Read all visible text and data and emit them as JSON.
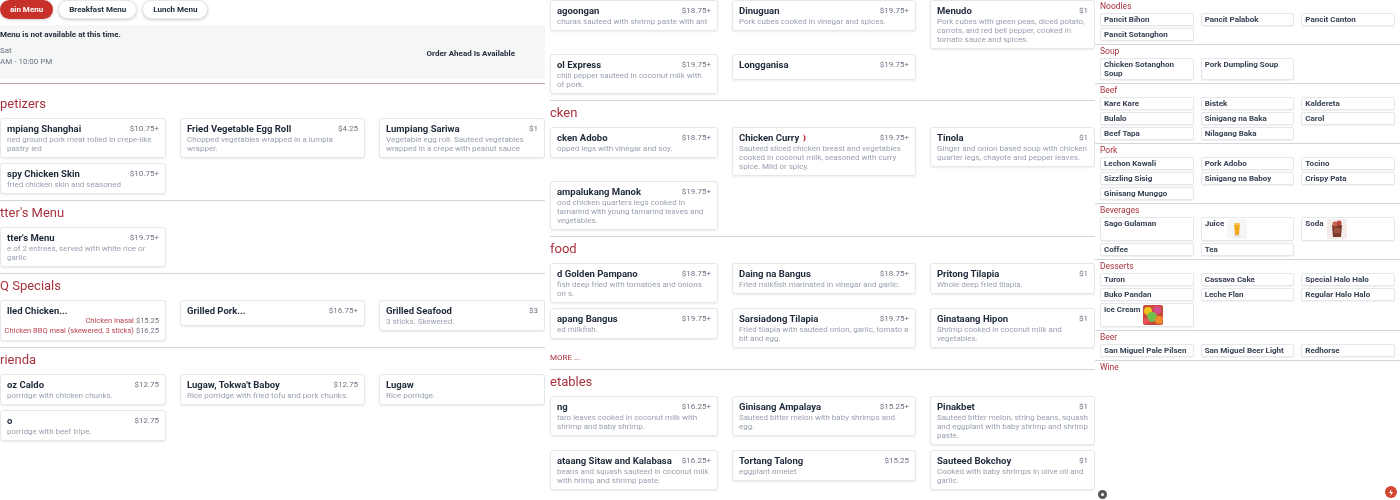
{
  "tabs": [
    {
      "label": "ain Menu",
      "selected": true
    },
    {
      "label": "Breakfast Menu",
      "selected": false
    },
    {
      "label": "Lunch Menu",
      "selected": false
    }
  ],
  "notice": {
    "message": "Menu is not available at this time.",
    "day": "Sat",
    "hours": "AM - 10:00 PM",
    "order_ahead": "Order Ahead Is Available"
  },
  "left_sections": [
    {
      "title": "petizers",
      "rows": [
        [
          {
            "name": "mpiang Shanghai",
            "price": "$10.75+",
            "description": "ned ground pork meat rolled in crepe-like pastry ied"
          },
          {
            "name": "Fried Vegetable Egg Roll",
            "price": "$4.25",
            "description": "Chopped vegetables wrapped in a lumpia wrapper."
          },
          {
            "name": "Lumpiang Sariwa",
            "price": "$1",
            "description": "Vegetable egg roll. Sauteed vegetables wrapped in a crepe with peanut sauce"
          }
        ],
        [
          {
            "name": "spy Chicken Skin",
            "price": "$10.75+",
            "description": "fried chicken skin and seasoned"
          }
        ]
      ]
    },
    {
      "title": "tter's Menu",
      "rows": [
        [
          {
            "name": "tter's Menu",
            "price": "$19.75+",
            "description": "e of 2 entrees, served with white rice or garlic"
          }
        ]
      ]
    },
    {
      "title": "Q Specials",
      "rows": [
        [
          {
            "name": "lled Chicken...",
            "options": [
              {
                "name": "Chicken Inasal",
                "price": "$15.25"
              },
              {
                "name": "Chicken BBQ meal (skewered, 3 sticks)",
                "price": "$16.25"
              }
            ]
          },
          {
            "name": "Grilled Pork...",
            "price": "$16.75+"
          },
          {
            "name": "Grilled Seafood",
            "price": "$3",
            "description": "3 sticks. Skewered."
          }
        ]
      ]
    },
    {
      "title": "rienda",
      "rows": [
        [
          {
            "name": "oz Caldo",
            "price": "$12.75",
            "description": "porridge with chicken chunks."
          },
          {
            "name": "Lugaw, Tokwa't Baboy",
            "price": "$12.75",
            "description": "Rice porridge with fried tofu and pork chunks."
          },
          {
            "name": "Lugaw",
            "description": "Rice porridge."
          }
        ],
        [
          {
            "name": "o",
            "price": "$12.75",
            "description": "porridge with beef tripe."
          }
        ]
      ]
    }
  ],
  "middle_sections": [
    {
      "rows": [
        [
          {
            "name": "agoongan",
            "price": "$18.75+",
            "description": "churas sauteed with shrimp paste with ant"
          },
          {
            "name": "Dinuguan",
            "price": "$19.75+",
            "description": "Pork cubes cooked in vinegar and spices."
          },
          {
            "name": "Menudo",
            "price": "$1",
            "description": "Pork cubes with green peas, diced potato, carrots, and red bell pepper, cooked in tomato sauce and spices."
          }
        ],
        [
          {
            "name": "ol Express",
            "price": "$19.75+",
            "description": "chili pepper sauteed in coconut milk with of pork."
          },
          {
            "name": "Longganisa",
            "price": "$19.75+"
          }
        ]
      ]
    },
    {
      "title": "cken",
      "rows": [
        [
          {
            "name": "cken Adobo",
            "price": "$18.75+",
            "description": "opped legs with vinegar and soy."
          },
          {
            "name": "Chicken Curry",
            "spicy": true,
            "price": "$19.75+",
            "description": "Sauteed sliced chicken breast and vegetables cooked in coconut milk, seasoned with curry spice. Mild or spicy."
          },
          {
            "name": "Tinola",
            "price": "$1",
            "description": "Ginger and onion based soup with chicken quarter legs, chayote and pepper leaves."
          }
        ],
        [
          {
            "name": "ampalukang Manok",
            "price": "$19.75+",
            "description": "ood chicken quarters legs cooked in tamarind with young tamarind leaves and vegetables."
          }
        ]
      ]
    },
    {
      "title": "food",
      "more": "MORE ...",
      "rows": [
        [
          {
            "name": "d Golden Pampano",
            "price": "$18.75+",
            "description": "fish deep fried with tomatoes and onions on s."
          },
          {
            "name": "Daing na Bangus",
            "price": "$18.75+",
            "description": "Fried milkfish marinated in vinegar and garlic."
          },
          {
            "name": "Pritong Tilapia",
            "price": "$1",
            "description": "Whole deep fried tilapia."
          }
        ],
        [
          {
            "name": "apang Bangus",
            "price": "$19.75+",
            "description": "ed milkfish."
          },
          {
            "name": "Sarsiadong Tilapia",
            "price": "$19.75+",
            "description": "Fried tilapia with sauteed onion, garlic, tomato a bit and egg."
          },
          {
            "name": "Ginataang Hipon",
            "price": "$1",
            "description": "Shrimp cooked in coconut milk and vegetables."
          }
        ]
      ]
    },
    {
      "title": "etables",
      "rows": [
        [
          {
            "name": "ng",
            "price": "$16.25+",
            "description": "taro leaves cooked in coconut milk with shrimp and baby shrimp."
          },
          {
            "name": "Ginisang Ampalaya",
            "price": "$15.25+",
            "description": "Sauteed bitter melon with baby shrimps and egg."
          },
          {
            "name": "Pinakbet",
            "price": "$1",
            "description": "Sauteed bitter melon, string beans, squash and eggplant with baby shrimp and shrimp paste."
          }
        ],
        [
          {
            "name": "ataang Sitaw and Kalabasa",
            "price": "$16.25+",
            "description": "beans and squash sauteed in coconut milk with hrimp and shrimp paste."
          },
          {
            "name": "Tortang Talong",
            "price": "$15.25",
            "description": "eggplant omelet"
          },
          {
            "name": "Sauteed Bokchoy",
            "price": "$1",
            "description": "Cooked with baby shrimps in olive oil and garlic."
          }
        ]
      ]
    }
  ],
  "right_sections": [
    {
      "title": "Noodles",
      "rows": [
        [
          {
            "name": "Pancit Bihon"
          },
          {
            "name": "Pancit Palabok"
          },
          {
            "name": "Pancit Canton"
          }
        ],
        [
          {
            "name": "Pancit Sotanghon"
          }
        ]
      ]
    },
    {
      "title": "Soup",
      "rows": [
        [
          {
            "name": "Chicken Sotanghon Soup"
          },
          {
            "name": "Pork Dumpling Soup"
          }
        ]
      ]
    },
    {
      "title": "Beef",
      "rows": [
        [
          {
            "name": "Kare Kare"
          },
          {
            "name": "Bistek"
          },
          {
            "name": "Kaldereta"
          }
        ],
        [
          {
            "name": "Bulalo"
          },
          {
            "name": "Sinigang na Baka"
          },
          {
            "name": "Carol"
          }
        ],
        [
          {
            "name": "Beef Tapa"
          },
          {
            "name": "Nilagang Baka"
          }
        ]
      ]
    },
    {
      "title": "Pork",
      "rows": [
        [
          {
            "name": "Lechon Kawali"
          },
          {
            "name": "Pork Adobo"
          },
          {
            "name": "Tocino"
          }
        ],
        [
          {
            "name": "Sizzling Sisig"
          },
          {
            "name": "Sinigang na Baboy"
          },
          {
            "name": "Crispy Pata"
          }
        ],
        [
          {
            "name": "Ginisang Munggo"
          }
        ]
      ]
    },
    {
      "title": "Beverages",
      "rows": [
        [
          {
            "name": "Sago Gulaman"
          },
          {
            "name": "Juice",
            "kind": "picture"
          },
          {
            "name": "Soda",
            "kind": "picture"
          }
        ],
        [
          {
            "name": "Coffee"
          },
          {
            "name": "Tea"
          }
        ]
      ]
    },
    {
      "title": "Desserts",
      "rows": [
        [
          {
            "name": "Turon"
          },
          {
            "name": "Cassava Cake"
          },
          {
            "name": "Special Halo Halo"
          }
        ],
        [
          {
            "name": "Buko Pandan"
          },
          {
            "name": "Leche Flan"
          },
          {
            "name": "Regular Halo Halo"
          }
        ],
        [
          {
            "name": "Ice Cream",
            "kind": "picture"
          }
        ]
      ]
    },
    {
      "title": "Beer",
      "rows": [
        [
          {
            "name": "San Miguel Pale Pilsen"
          },
          {
            "name": "San Miguel Beer Light"
          },
          {
            "name": "Redhorse"
          }
        ]
      ]
    },
    {
      "title": "Wine"
    }
  ]
}
